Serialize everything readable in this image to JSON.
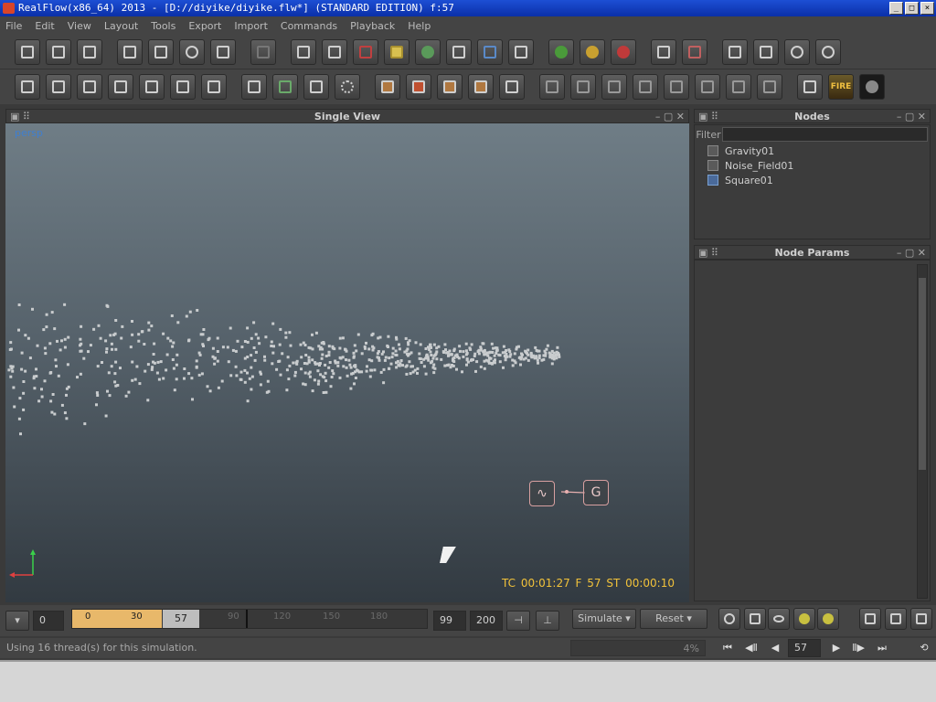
{
  "window": {
    "title": "RealFlow(x86_64) 2013 - [D://diyike/diyike.flw*] (STANDARD EDITION) f:57"
  },
  "menu": [
    "File",
    "Edit",
    "View",
    "Layout",
    "Tools",
    "Export",
    "Import",
    "Commands",
    "Playback",
    "Help"
  ],
  "viewport": {
    "title": "Single View",
    "camera": "persp",
    "hud": "TC 00:01:27   F 57   ST 00:00:10",
    "gizmo_noise_label": "noise-field-gizmo",
    "gizmo_gravity_label": "G"
  },
  "nodes_panel": {
    "title": "Nodes",
    "filter_label": "Filter",
    "filter_value": "",
    "items": [
      {
        "label": "Gravity01",
        "icon": "daemon-icon"
      },
      {
        "label": "Noise_Field01",
        "icon": "daemon-icon"
      },
      {
        "label": "Square01",
        "icon": "emitter-icon"
      }
    ]
  },
  "params_panel": {
    "title": "Node Params"
  },
  "timeline": {
    "start_frame": "0",
    "range_start": "0",
    "tick_30": "30",
    "current_frame": "57",
    "tick_90": "90",
    "tick_120": "120",
    "tick_150": "150",
    "tick_180": "180",
    "range_end": "99",
    "end_frame": "200",
    "simulate_label": "Simulate",
    "reset_label": "Reset"
  },
  "status": {
    "message": "Using 16 thread(s) for this simulation.",
    "progress": "4%",
    "frame_field": "57",
    "fire_label": "FIRE"
  },
  "colors": {
    "accent": "#f2c23a",
    "range": "#e8b86a"
  }
}
